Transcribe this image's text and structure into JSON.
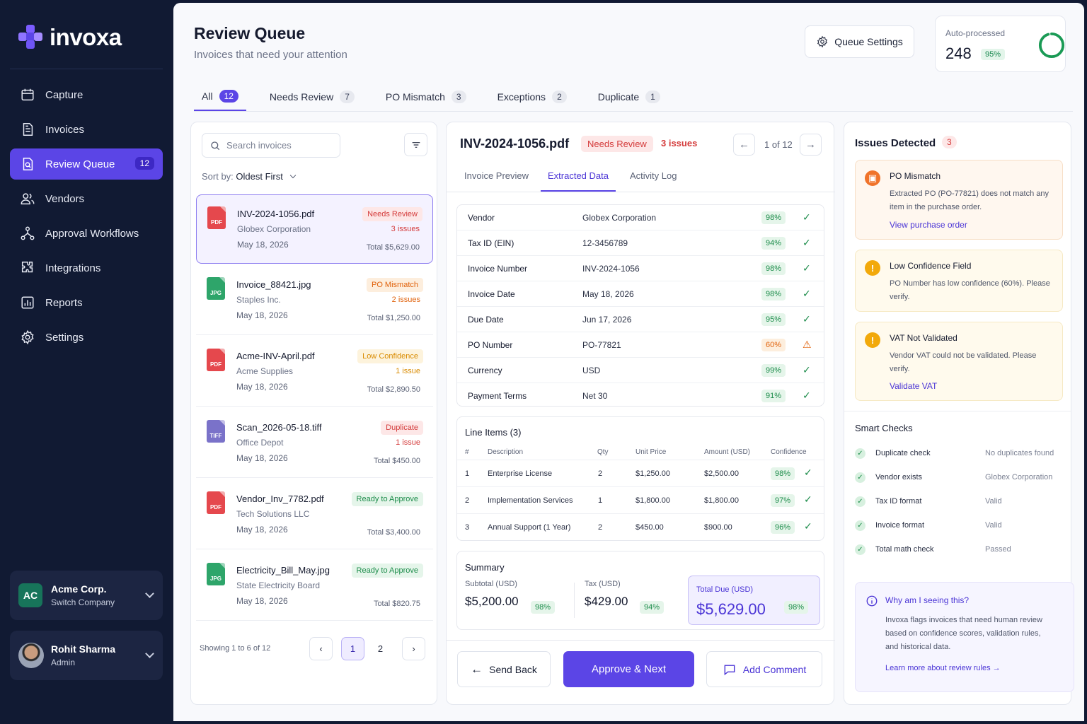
{
  "brand": {
    "name": "invoxa",
    "accent": "#5b45e6"
  },
  "sidebar": {
    "items": [
      {
        "label": "Capture",
        "icon": "calendar-icon"
      },
      {
        "label": "Invoices",
        "icon": "document-icon"
      },
      {
        "label": "Review Queue",
        "icon": "review-icon",
        "badge": "12"
      },
      {
        "label": "Vendors",
        "icon": "users-icon"
      },
      {
        "label": "Approval Workflows",
        "icon": "workflow-icon"
      },
      {
        "label": "Integrations",
        "icon": "puzzle-icon"
      },
      {
        "label": "Reports",
        "icon": "chart-icon"
      },
      {
        "label": "Settings",
        "icon": "gear-icon"
      }
    ],
    "company": {
      "initials": "AC",
      "name": "Acme Corp.",
      "sub": "Switch Company"
    },
    "user": {
      "name": "Rohit Sharma",
      "role": "Admin"
    }
  },
  "header": {
    "title": "Review Queue",
    "subtitle": "Invoices that need your attention",
    "queue_settings": "Queue Settings",
    "auto": {
      "label": "Auto-processed",
      "value": "248",
      "pct": "95%",
      "fraction": 0.95
    }
  },
  "tabs": [
    {
      "label": "All",
      "count": "12"
    },
    {
      "label": "Needs Review",
      "count": "7"
    },
    {
      "label": "PO Mismatch",
      "count": "3"
    },
    {
      "label": "Exceptions",
      "count": "2"
    },
    {
      "label": "Duplicate",
      "count": "1"
    }
  ],
  "list": {
    "search_placeholder": "Search invoices",
    "sort_label": "Sort by:",
    "sort_value": "Oldest First",
    "items": [
      {
        "file": "INV-2024-1056.pdf",
        "type": "PDF",
        "vendor": "Globex Corporation",
        "date": "May 18, 2026",
        "status": "Needs Review",
        "issues": "3 issues",
        "total": "Total $5,629.00"
      },
      {
        "file": "Invoice_88421.jpg",
        "type": "JPG",
        "vendor": "Staples Inc.",
        "date": "May 18, 2026",
        "status": "PO Mismatch",
        "issues": "2 issues",
        "total": "Total $1,250.00"
      },
      {
        "file": "Acme-INV-April.pdf",
        "type": "PDF",
        "vendor": "Acme Supplies",
        "date": "May 18, 2026",
        "status": "Low Confidence",
        "issues": "1 issue",
        "total": "Total $2,890.50"
      },
      {
        "file": "Scan_2026-05-18.tiff",
        "type": "TIFF",
        "vendor": "Office Depot",
        "date": "May 18, 2026",
        "status": "Duplicate",
        "issues": "1 issue",
        "total": "Total $450.00"
      },
      {
        "file": "Vendor_Inv_7782.pdf",
        "type": "PDF",
        "vendor": "Tech Solutions LLC",
        "date": "May 18, 2026",
        "status": "Ready to Approve",
        "issues": "",
        "total": "Total $3,400.00"
      },
      {
        "file": "Electricity_Bill_May.jpg",
        "type": "JPG",
        "vendor": "State Electricity Board",
        "date": "May 18, 2026",
        "status": "Ready to Approve",
        "issues": "",
        "total": "Total $820.75"
      }
    ],
    "showing": "Showing 1 to 6 of 12",
    "pages": [
      "1",
      "2"
    ]
  },
  "detail": {
    "file": "INV-2024-1056.pdf",
    "status": "Needs Review",
    "issues": "3 issues",
    "position": "1 of 12",
    "tabs": [
      "Invoice Preview",
      "Extracted Data",
      "Activity Log"
    ],
    "fields": [
      {
        "label": "Vendor",
        "value": "Globex Corporation",
        "conf": "98%"
      },
      {
        "label": "Tax ID (EIN)",
        "value": "12-3456789",
        "conf": "94%"
      },
      {
        "label": "Invoice Number",
        "value": "INV-2024-1056",
        "conf": "98%"
      },
      {
        "label": "Invoice Date",
        "value": "May 18, 2026",
        "conf": "98%"
      },
      {
        "label": "Due Date",
        "value": "Jun 17, 2026",
        "conf": "95%"
      },
      {
        "label": "PO Number",
        "value": "PO-77821",
        "conf": "60%"
      },
      {
        "label": "Currency",
        "value": "USD",
        "conf": "99%"
      },
      {
        "label": "Payment Terms",
        "value": "Net 30",
        "conf": "91%"
      }
    ],
    "line_items": {
      "title": "Line Items (3)",
      "headers": [
        "#",
        "Description",
        "Qty",
        "Unit Price",
        "Amount (USD)",
        "Confidence"
      ],
      "rows": [
        {
          "n": "1",
          "desc": "Enterprise License",
          "qty": "2",
          "unit": "$1,250.00",
          "amount": "$2,500.00",
          "conf": "98%"
        },
        {
          "n": "2",
          "desc": "Implementation Services",
          "qty": "1",
          "unit": "$1,800.00",
          "amount": "$1,800.00",
          "conf": "97%"
        },
        {
          "n": "3",
          "desc": "Annual Support (1 Year)",
          "qty": "2",
          "unit": "$450.00",
          "amount": "$900.00",
          "conf": "96%"
        }
      ]
    },
    "summary": {
      "title": "Summary",
      "subtotal_label": "Subtotal (USD)",
      "subtotal": "$5,200.00",
      "subtotal_conf": "98%",
      "tax_label": "Tax (USD)",
      "tax": "$429.00",
      "tax_conf": "94%",
      "total_label": "Total Due (USD)",
      "total": "$5,629.00",
      "total_conf": "98%"
    },
    "actions": {
      "send_back": "Send Back",
      "approve": "Approve & Next",
      "comment": "Add Comment"
    }
  },
  "issues": {
    "title": "Issues Detected",
    "count": "3",
    "items": [
      {
        "title": "PO Mismatch",
        "text": "Extracted PO (PO-77821) does not match any item in the purchase order.",
        "link": "View purchase order"
      },
      {
        "title": "Low Confidence Field",
        "text": "PO Number has low confidence (60%). Please verify.",
        "link": ""
      },
      {
        "title": "VAT Not Validated",
        "text": "Vendor VAT could not be validated. Please verify.",
        "link": "Validate VAT"
      }
    ]
  },
  "smart_checks": {
    "title": "Smart Checks",
    "items": [
      {
        "label": "Duplicate check",
        "value": "No duplicates found"
      },
      {
        "label": "Vendor exists",
        "value": "Globex Corporation"
      },
      {
        "label": "Tax ID format",
        "value": "Valid"
      },
      {
        "label": "Invoice format",
        "value": "Valid"
      },
      {
        "label": "Total math check",
        "value": "Passed"
      }
    ]
  },
  "why": {
    "title": "Why am I seeing this?",
    "text": "Invoxa flags invoices that need human review based on confidence scores, validation rules, and historical data.",
    "link": "Learn more about review rules"
  }
}
